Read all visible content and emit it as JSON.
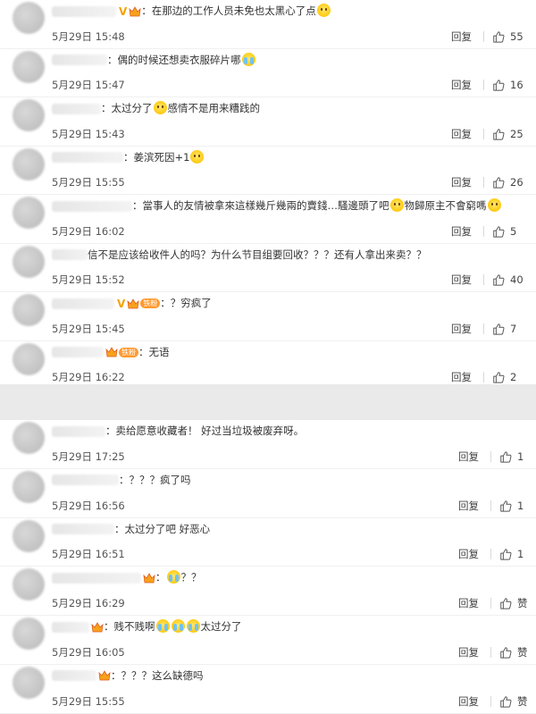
{
  "panel1": [
    {
      "prefix": "",
      "text": "：在那边的工作人员未免也太黑心了点",
      "text_after": "",
      "emojis_mid": 0,
      "emojis_end": 1,
      "emoji_kind": "smile",
      "v_badge": true,
      "crown": true,
      "fans_badge": "",
      "date": "5月29日 15:48",
      "reply": "回复",
      "likes": "55"
    },
    {
      "prefix": "",
      "text": "：偶的时候还想卖衣服碎片哪",
      "text_after": "",
      "emojis_mid": 0,
      "emojis_end": 1,
      "emoji_kind": "cry",
      "v_badge": false,
      "crown": false,
      "fans_badge": "",
      "date": "5月29日 15:47",
      "reply": "回复",
      "likes": "16"
    },
    {
      "prefix": "",
      "text": "：太过分了",
      "text_after": "感情不是用来糟践的",
      "emojis_mid": 1,
      "emojis_end": 0,
      "emoji_kind": "smile",
      "v_badge": false,
      "crown": false,
      "fans_badge": "",
      "date": "5月29日 15:43",
      "reply": "回复",
      "likes": "25"
    },
    {
      "prefix": "",
      "text": "：姜滨死因+1",
      "text_after": "",
      "emojis_mid": 0,
      "emojis_end": 1,
      "emoji_kind": "smile",
      "v_badge": false,
      "crown": false,
      "fans_badge": "",
      "date": "5月29日 15:55",
      "reply": "回复",
      "likes": "26"
    },
    {
      "prefix": "",
      "text": "：當事人的友情被拿來這樣幾斤幾兩的賣錢…騷邊頭了吧",
      "text_after": "物歸原主不會窮嗎",
      "emojis_mid": 1,
      "emojis_end": 1,
      "emoji_kind": "smile",
      "v_badge": false,
      "crown": false,
      "fans_badge": "",
      "date": "5月29日 16:02",
      "reply": "回复",
      "likes": "5"
    },
    {
      "prefix": "",
      "text": "信不是应该给收件人的吗？为什么节目组要回收？？？还有人拿出来卖？？",
      "text_after": "",
      "emojis_mid": 0,
      "emojis_end": 0,
      "emoji_kind": "smile",
      "v_badge": false,
      "crown": false,
      "fans_badge": "",
      "date": "5月29日 15:52",
      "reply": "回复",
      "likes": "40"
    },
    {
      "prefix": "",
      "text": "：？穷疯了",
      "text_after": "",
      "emojis_mid": 0,
      "emojis_end": 0,
      "emoji_kind": "smile",
      "v_badge": true,
      "crown": true,
      "fans_badge": "铁粉",
      "date": "5月29日 15:45",
      "reply": "回复",
      "likes": "7"
    },
    {
      "prefix": "",
      "text": "：无语",
      "text_after": "",
      "emojis_mid": 0,
      "emojis_end": 0,
      "emoji_kind": "smile",
      "v_badge": false,
      "crown": true,
      "fans_badge": "铁粉",
      "date": "5月29日 16:22",
      "reply": "回复",
      "likes": "2"
    }
  ],
  "panel2": [
    {
      "text": "：卖给愿意收藏者！ 好过当垃圾被废弃呀。",
      "text_after": "",
      "emojis_mid": 0,
      "emojis_end": 0,
      "emoji_kind": "smile",
      "crown": false,
      "date": "5月29日 17:25",
      "reply": "回复",
      "likes": "1"
    },
    {
      "text": "：？？？疯了吗",
      "text_after": "",
      "emojis_mid": 0,
      "emojis_end": 0,
      "emoji_kind": "smile",
      "crown": false,
      "date": "5月29日 16:56",
      "reply": "回复",
      "likes": "1"
    },
    {
      "text": "：太过分了吧 好恶心",
      "text_after": "",
      "emojis_mid": 0,
      "emojis_end": 0,
      "emoji_kind": "smile",
      "crown": false,
      "date": "5月29日 16:51",
      "reply": "回复",
      "likes": "1"
    },
    {
      "text": "：",
      "text_after": "？？",
      "emojis_mid": 1,
      "emojis_end": 0,
      "emoji_kind": "cry",
      "crown": true,
      "date": "5月29日 16:29",
      "reply": "回复",
      "likes": "赞"
    },
    {
      "text": "：贱不贱啊",
      "text_after": "太过分了",
      "emojis_mid": 3,
      "emojis_end": 0,
      "emoji_kind": "cry",
      "crown": true,
      "date": "5月29日 16:05",
      "reply": "回复",
      "likes": "赞"
    },
    {
      "text": "：？？？这么缺德吗",
      "text_after": "",
      "emojis_mid": 0,
      "emojis_end": 0,
      "emoji_kind": "smile",
      "crown": true,
      "date": "5月29日 15:55",
      "reply": "回复",
      "likes": "赞"
    }
  ]
}
